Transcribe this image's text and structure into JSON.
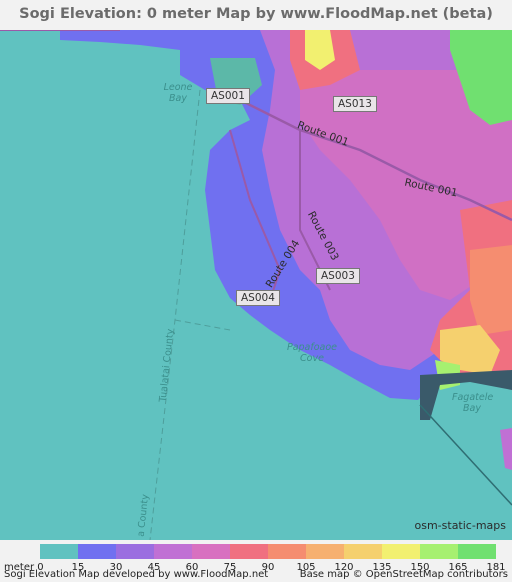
{
  "title": "Sogi Elevation: 0 meter Map by www.FloodMap.net (beta)",
  "map": {
    "road_shields": [
      "AS001",
      "AS013",
      "AS003",
      "AS004"
    ],
    "road_names": [
      "Route 001",
      "Route 001",
      "Route 003",
      "Route 004"
    ],
    "water_labels": [
      "Leone Bay",
      "Papafoaoe Cove",
      "Fagatele Bay"
    ],
    "county_labels": [
      "Tualatai County",
      "a County"
    ],
    "attribution_box": "osm-static-maps"
  },
  "legend": {
    "unit": "meter",
    "ticks": [
      "0",
      "15",
      "30",
      "45",
      "60",
      "75",
      "90",
      "105",
      "120",
      "135",
      "150",
      "165",
      "181"
    ],
    "colors": [
      "#60c2c0",
      "#7070f0",
      "#9b6ee0",
      "#c070d4",
      "#d870c0",
      "#f07080",
      "#f58d70",
      "#f6b070",
      "#f5d06e",
      "#f2f070",
      "#a6f070",
      "#70e070"
    ]
  },
  "footer": {
    "left": "Sogi Elevation Map developed by www.FloodMap.net",
    "right": "Base map © OpenStreetMap contributors"
  }
}
